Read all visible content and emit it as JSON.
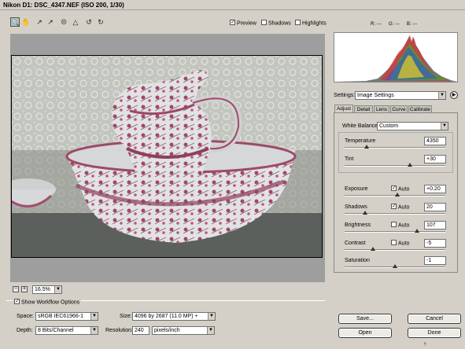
{
  "window": {
    "title": "Nikon D1:  DSC_4347.NEF  (ISO 200, 1/30)"
  },
  "toolbar": {
    "tools": [
      "zoom-icon",
      "hand-icon",
      "white-balance-icon",
      "color-sampler-icon",
      "crop-icon",
      "straighten-icon",
      "rotate-left-icon",
      "rotate-right-icon"
    ],
    "preview": {
      "label": "Preview",
      "checked": true
    },
    "shadows": {
      "label": "Shadows",
      "checked": false
    },
    "highlights": {
      "label": "Highlights",
      "checked": false
    },
    "rgb": {
      "r": "R:  ---",
      "g": "G:  ---",
      "b": "B:  ---"
    }
  },
  "zoom": {
    "value": "16.5%",
    "minus": "−",
    "plus": "+"
  },
  "workflow": {
    "show_label": "Show Workflow Options",
    "show_checked": true,
    "space_label": "Space:",
    "space_value": "sRGB IEC61966-1",
    "depth_label": "Depth:",
    "depth_value": "8 Bits/Channel",
    "size_label": "Size:",
    "size_value": "4096 by 2687  (11.0 MP)   +",
    "resolution_label": "Resolution:",
    "resolution_value": "240",
    "resolution_unit": "pixels/inch"
  },
  "settings": {
    "label": "Settings:",
    "value": "Image Settings"
  },
  "tabs": [
    {
      "label": "Adjust",
      "active": true
    },
    {
      "label": "Detail"
    },
    {
      "label": "Lens"
    },
    {
      "label": "Curve"
    },
    {
      "label": "Calibrate"
    }
  ],
  "adjust": {
    "white_balance_label": "White Balance:",
    "white_balance_value": "Custom",
    "auto_label": "Auto",
    "controls": [
      {
        "name": "temperature",
        "label": "Temperature",
        "value": "4350",
        "level": 0.22
      },
      {
        "name": "tint",
        "label": "Tint",
        "value": "+30",
        "level": 0.65
      },
      {
        "name": "exposure",
        "label": "Exposure",
        "value": "+0.20",
        "auto": true,
        "level": 0.52
      },
      {
        "name": "shadows",
        "label": "Shadows",
        "value": "20",
        "auto": true,
        "level": 0.2
      },
      {
        "name": "brightness",
        "label": "Brightness",
        "value": "107",
        "auto": false,
        "level": 0.72
      },
      {
        "name": "contrast",
        "label": "Contrast",
        "value": "-5",
        "auto": false,
        "level": 0.28
      },
      {
        "name": "saturation",
        "label": "Saturation",
        "value": "-1",
        "level": 0.5
      }
    ]
  },
  "buttons": {
    "save": "Save...",
    "cancel": "Cancel",
    "open": "Open",
    "done": "Done"
  }
}
